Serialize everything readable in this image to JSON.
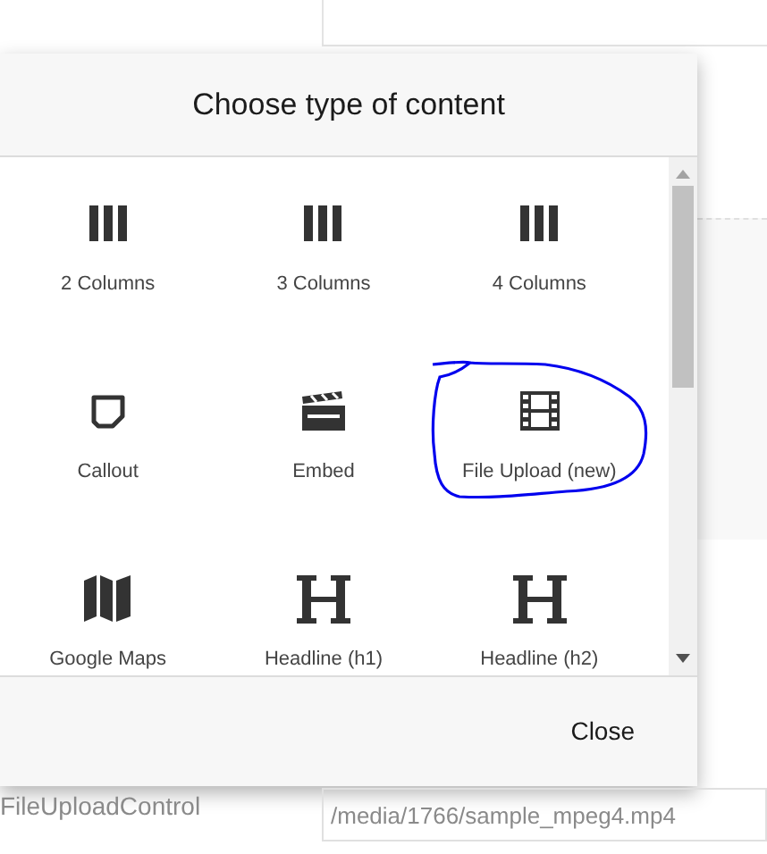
{
  "dialog": {
    "title": "Choose type of content",
    "items": [
      {
        "label": "2 Columns",
        "kind": "columns",
        "highlighted": false
      },
      {
        "label": "3 Columns",
        "kind": "columns",
        "highlighted": false
      },
      {
        "label": "4 Columns",
        "kind": "columns",
        "highlighted": false
      },
      {
        "label": "Callout",
        "kind": "callout",
        "highlighted": false
      },
      {
        "label": "Embed",
        "kind": "embed",
        "highlighted": false
      },
      {
        "label": "File Upload (new)",
        "kind": "film",
        "highlighted": true
      },
      {
        "label": "Google Maps",
        "kind": "map",
        "highlighted": false
      },
      {
        "label": "Headline (h1)",
        "kind": "heading",
        "highlighted": false
      },
      {
        "label": "Headline (h2)",
        "kind": "heading",
        "highlighted": false
      }
    ],
    "close_button": "Close"
  },
  "form": {
    "label": "FileUploadControl",
    "value": "/media/1766/sample_mpeg4.mp4"
  }
}
